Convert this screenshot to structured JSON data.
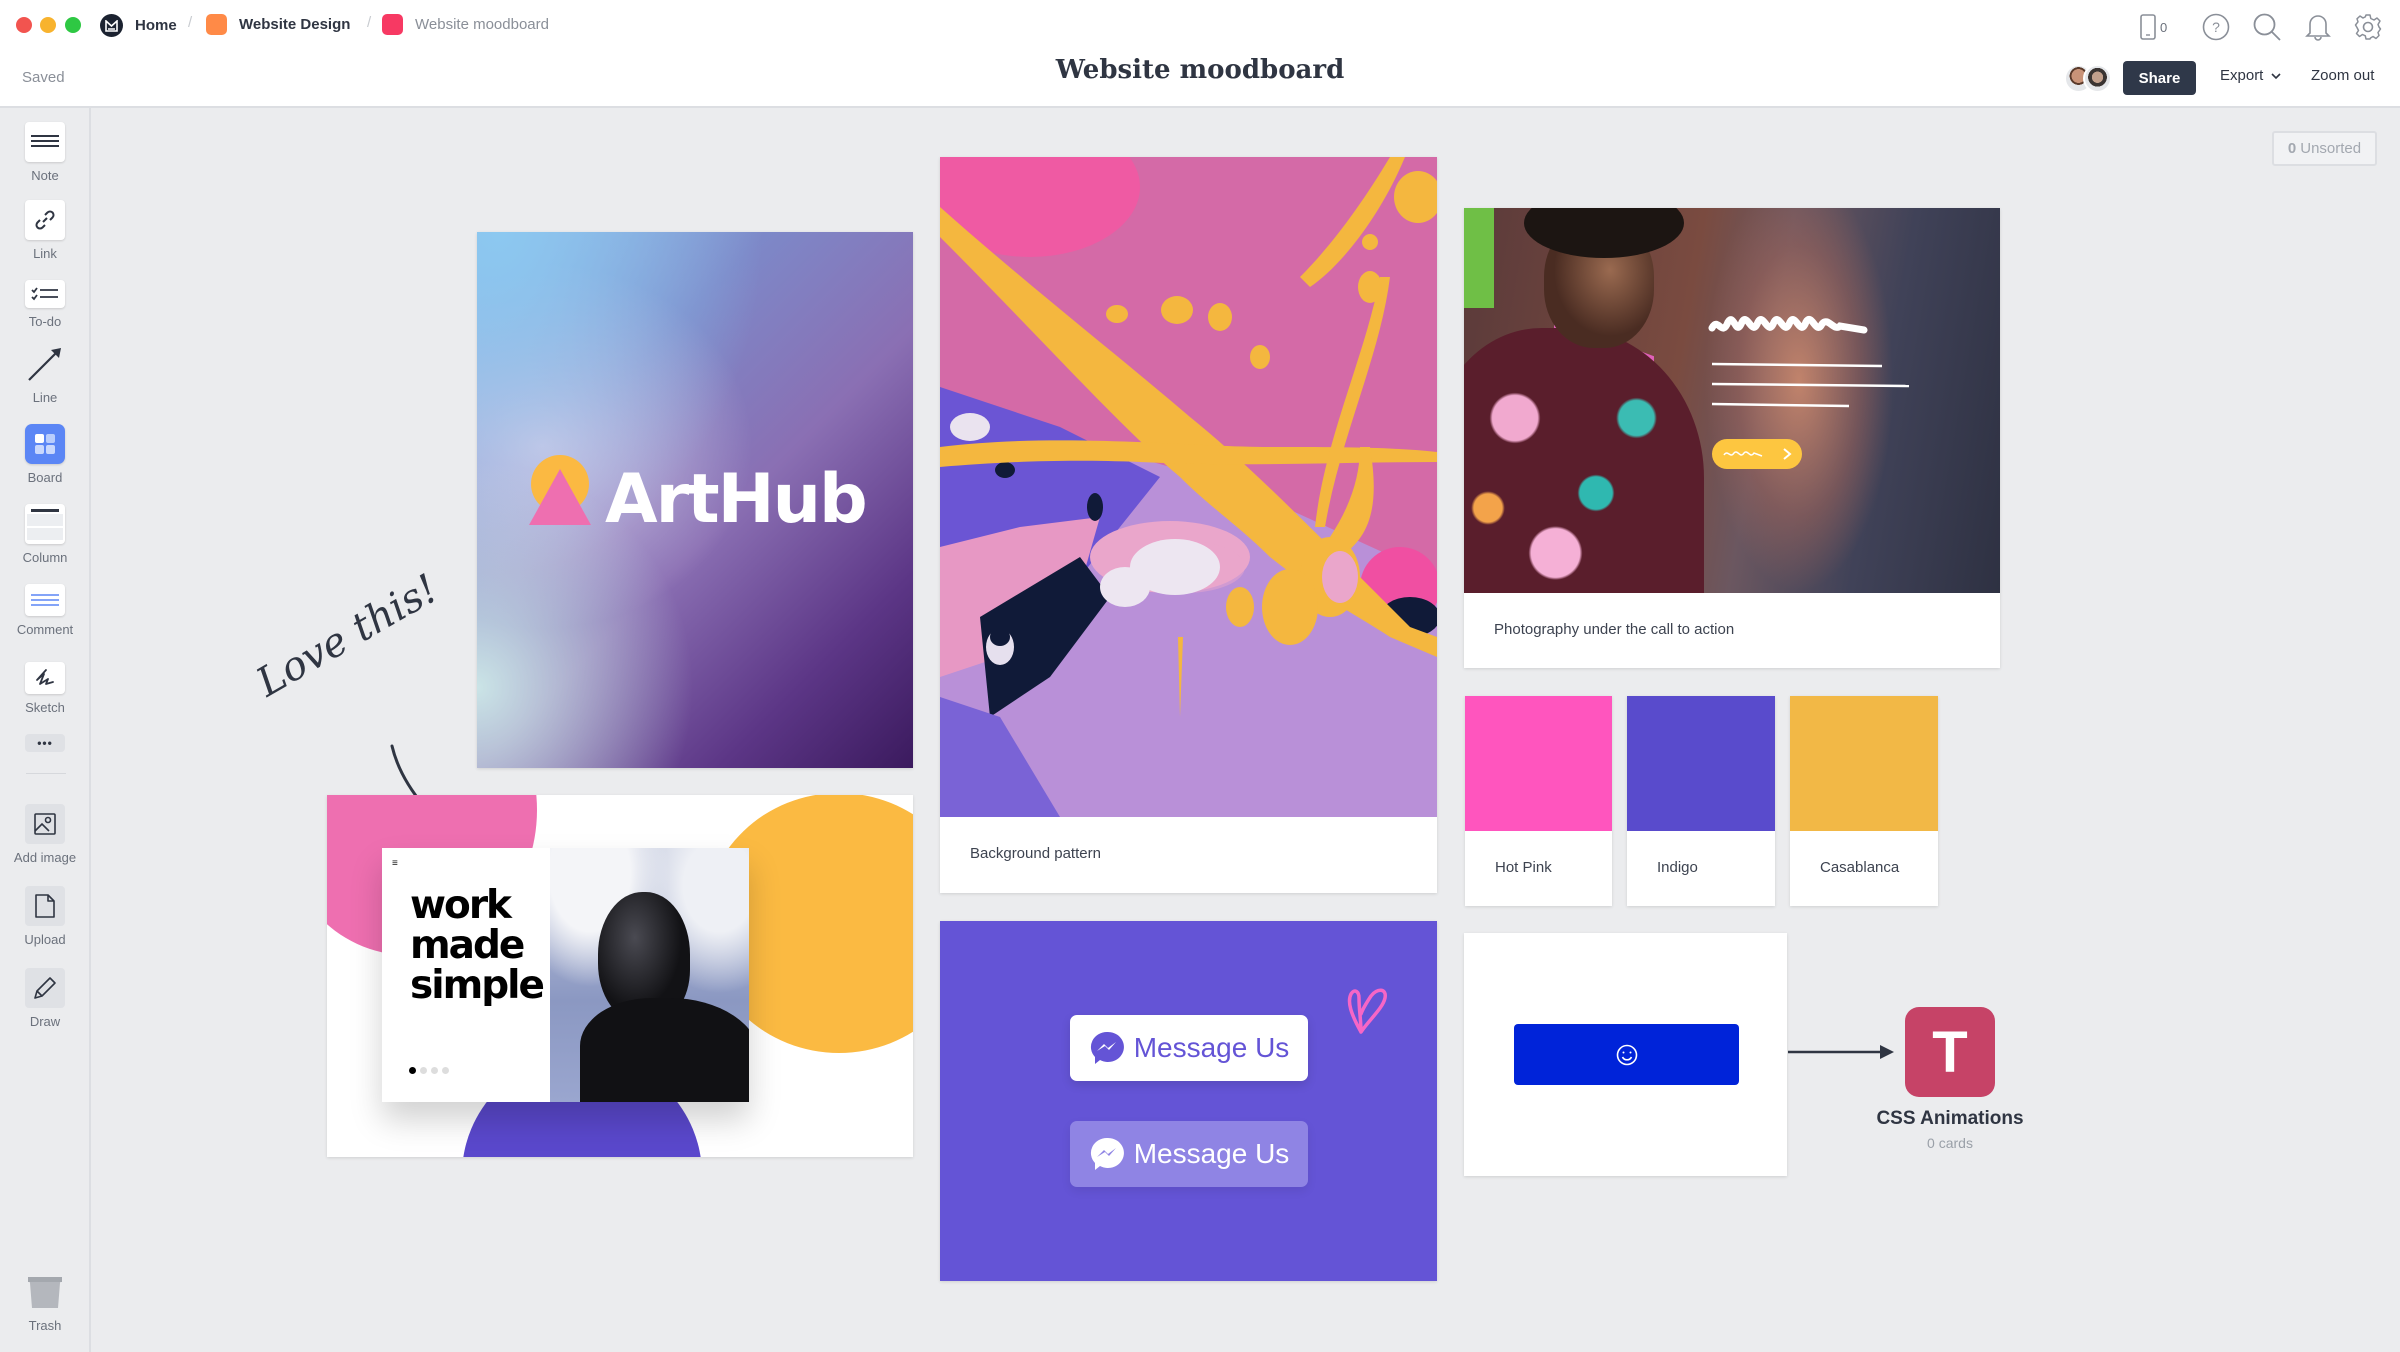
{
  "window": {
    "traffic_lights": {
      "close": "#f2544f",
      "minimize": "#f8b32e",
      "maximize": "#2ec843"
    }
  },
  "breadcrumb": [
    {
      "label": "Home",
      "icon": "milanote-logo-icon",
      "color": "#1b2230"
    },
    {
      "label": "Website Design",
      "icon": "board-icon",
      "color": "#ff8a47"
    },
    {
      "label": "Website moodboard",
      "icon": "board-icon",
      "color": "#f73963"
    }
  ],
  "header": {
    "status": "Saved",
    "title": "Website moodboard",
    "device_count": "0",
    "share_label": "Share",
    "export_label": "Export",
    "zoom_out_label": "Zoom out"
  },
  "sidebar": {
    "tools": [
      {
        "label": "Note",
        "icon": "note-icon"
      },
      {
        "label": "Link",
        "icon": "link-icon"
      },
      {
        "label": "To-do",
        "icon": "todo-icon"
      },
      {
        "label": "Line",
        "icon": "line-icon"
      },
      {
        "label": "Board",
        "icon": "board-icon"
      },
      {
        "label": "Column",
        "icon": "column-icon"
      },
      {
        "label": "Comment",
        "icon": "comment-icon"
      },
      {
        "label": "Sketch",
        "icon": "sketch-icon"
      }
    ],
    "more_label": "•••",
    "media_tools": [
      {
        "label": "Add image",
        "icon": "image-icon"
      },
      {
        "label": "Upload",
        "icon": "file-icon"
      },
      {
        "label": "Draw",
        "icon": "pencil-icon"
      }
    ],
    "trash_label": "Trash"
  },
  "canvas": {
    "unsorted": {
      "count": "0",
      "label": "Unsorted"
    },
    "arthub": {
      "logo_text": "ArtHub"
    },
    "annotation": {
      "text": "Love this!"
    },
    "work_card": {
      "headline": [
        "work",
        "made",
        "simple"
      ],
      "carousel": {
        "total": 4,
        "active": 1
      }
    },
    "background_pattern": {
      "caption": "Background pattern"
    },
    "photo_card": {
      "caption": "Photography under the call to action"
    },
    "swatches": [
      {
        "name": "Hot Pink",
        "color": "#ff55be"
      },
      {
        "name": "Indigo",
        "color": "#594bcc"
      },
      {
        "name": "Casablanca",
        "color": "#f2b846"
      }
    ],
    "message_card": {
      "background": "#6454d6",
      "buttons": [
        {
          "label": "Message Us",
          "style": "solid"
        },
        {
          "label": "Message Us",
          "style": "ghost"
        }
      ]
    },
    "smiley_card": {
      "button_color": "#0023d9"
    },
    "board_link": {
      "title": "CSS Animations",
      "subtitle": "0 cards",
      "letter": "T",
      "color": "#c64367"
    }
  }
}
